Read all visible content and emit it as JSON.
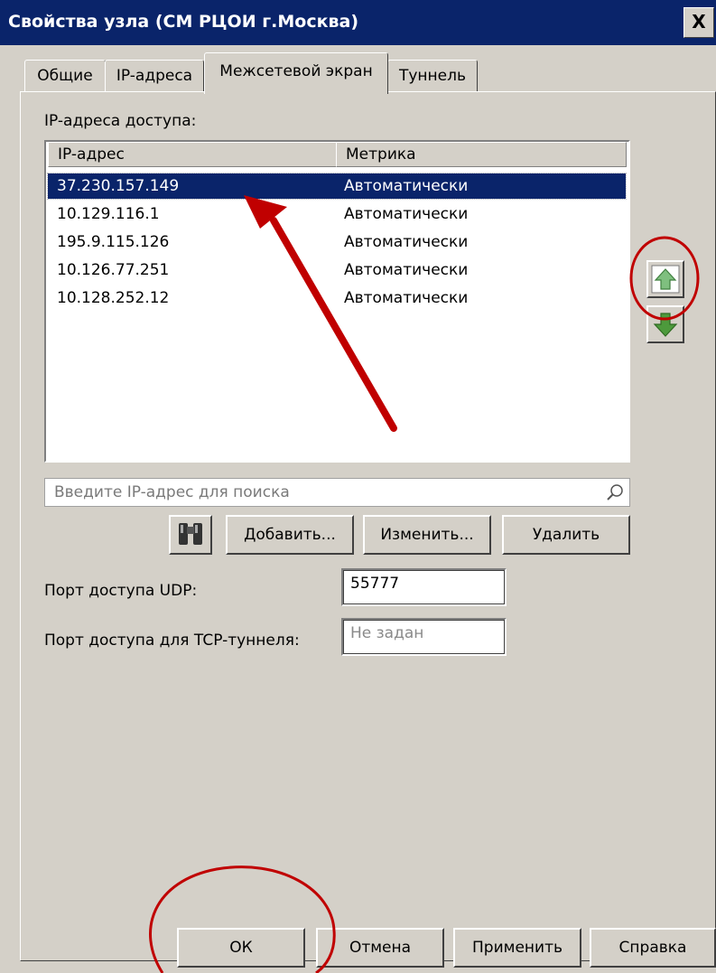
{
  "window": {
    "title": "Свойства узла (СМ РЦОИ г.Москва)",
    "close_label": "X"
  },
  "tabs": [
    {
      "label": "Общие",
      "active": false
    },
    {
      "label": "IP-адреса",
      "active": false
    },
    {
      "label": "Межсетевой экран",
      "active": true
    },
    {
      "label": "Туннель",
      "active": false
    }
  ],
  "firewall": {
    "ip_list_label": "IP-адреса доступа:",
    "columns": [
      "IP-адрес",
      "Метрика"
    ],
    "rows": [
      {
        "ip": "37.230.157.149",
        "metric": "Автоматически",
        "selected": true
      },
      {
        "ip": "10.129.116.1",
        "metric": "Автоматически",
        "selected": false
      },
      {
        "ip": "195.9.115.126",
        "metric": "Автоматически",
        "selected": false
      },
      {
        "ip": "10.126.77.251",
        "metric": "Автоматически",
        "selected": false
      },
      {
        "ip": "10.128.252.12",
        "metric": "Автоматически",
        "selected": false
      }
    ],
    "search_placeholder": "Введите IP-адрес для поиска",
    "buttons": {
      "add": "Добавить...",
      "edit": "Изменить...",
      "delete": "Удалить"
    },
    "udp_port_label": "Порт доступа UDP:",
    "udp_port_value": "55777",
    "tcp_port_label": "Порт доступа для TCP-туннеля:",
    "tcp_port_placeholder": "Не задан"
  },
  "footer": {
    "ok": "ОК",
    "cancel": "Отмена",
    "apply": "Применить",
    "help": "Справка"
  },
  "colors": {
    "titlebar": "#0a246a",
    "annotation": "#c00000"
  },
  "icons": [
    "binoculars-icon",
    "arrow-up-icon",
    "arrow-down-icon",
    "magnifier-icon",
    "close-icon"
  ]
}
